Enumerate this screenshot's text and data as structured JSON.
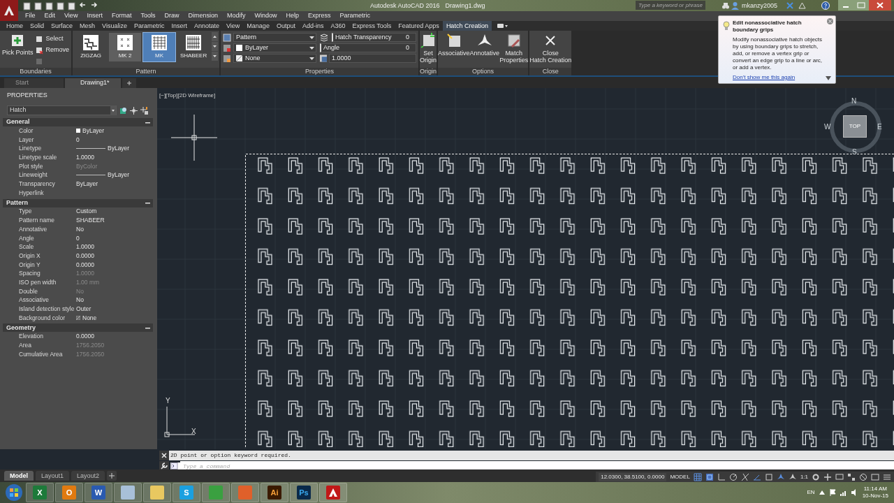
{
  "title_bar": {
    "title": "Autodesk AutoCAD 2016",
    "document": "Drawing1.dwg",
    "search": {
      "placeholder": "Type a keyword or phrase"
    },
    "user": "mkanzy2005"
  },
  "menu_bar": [
    "File",
    "Edit",
    "View",
    "Insert",
    "Format",
    "Tools",
    "Draw",
    "Dimension",
    "Modify",
    "Window",
    "Help",
    "Express",
    "Parametric"
  ],
  "ribbon_tabs": [
    {
      "label": "Home",
      "selected": false
    },
    {
      "label": "Solid",
      "selected": false
    },
    {
      "label": "Surface",
      "selected": false
    },
    {
      "label": "Mesh",
      "selected": false
    },
    {
      "label": "Visualize",
      "selected": false
    },
    {
      "label": "Parametric",
      "selected": false
    },
    {
      "label": "Insert",
      "selected": false
    },
    {
      "label": "Annotate",
      "selected": false
    },
    {
      "label": "View",
      "selected": false
    },
    {
      "label": "Manage",
      "selected": false
    },
    {
      "label": "Output",
      "selected": false
    },
    {
      "label": "Add-ins",
      "selected": false
    },
    {
      "label": "A360",
      "selected": false
    },
    {
      "label": "Express Tools",
      "selected": false
    },
    {
      "label": "Featured Apps",
      "selected": false
    },
    {
      "label": "Hatch Creation",
      "selected": true
    }
  ],
  "ribbon": {
    "boundaries": {
      "title": "Boundaries",
      "pick_points": "Pick Points",
      "tools": [
        {
          "label": "Select",
          "disabled": false
        },
        {
          "label": "Remove",
          "disabled": false
        },
        {
          "disabled": true
        }
      ]
    },
    "pattern": {
      "title": "Pattern",
      "items": [
        {
          "label": "ZIGZAG",
          "selected": false,
          "hovered": false
        },
        {
          "label": "MK 2",
          "selected": false,
          "hovered": true
        },
        {
          "label": "MK",
          "selected": true,
          "hovered": false
        },
        {
          "label": "SHABEER",
          "selected": false,
          "hovered": false
        }
      ]
    },
    "properties": {
      "title": "Properties",
      "type": "Pattern",
      "hatch_color": "ByLayer",
      "background": "None",
      "transparency": {
        "label": "Hatch Transparency",
        "value": "0"
      },
      "angle": {
        "label": "Angle",
        "value": "0"
      },
      "scale": "1.0000"
    },
    "origin": {
      "title": "Origin",
      "button": [
        "Set",
        "Origin"
      ]
    },
    "options": {
      "title": "Options",
      "buttons": [
        {
          "kind": "associative",
          "lines": [
            "Associative"
          ]
        },
        {
          "kind": "annotative",
          "lines": [
            "Annotative"
          ]
        },
        {
          "kind": "match",
          "lines": [
            "Match",
            "Properties"
          ]
        }
      ]
    },
    "close": {
      "title": "Close",
      "button": [
        "Close",
        "Hatch Creation"
      ]
    }
  },
  "tooltip": {
    "title": "Edit nonassociative hatch boundary grips",
    "body": "Modify nonassociative hatch objects by using boundary grips to stretch, add, or remove a vertex grip or convert an edge grip to a line or arc, or add a vertex.",
    "link": "Don't show me this again"
  },
  "document_tabs": [
    {
      "label": "Start",
      "selected": false
    },
    {
      "label": "Drawing1*",
      "selected": true
    }
  ],
  "properties_palette": {
    "title": "PROPERTIES",
    "object": "Hatch",
    "sections": [
      {
        "title": "General",
        "expanded": true,
        "rows": [
          {
            "label": "Color",
            "value": "ByLayer",
            "kind": "swatch",
            "disabled": false
          },
          {
            "label": "Layer",
            "value": "0",
            "kind": "text",
            "disabled": false
          },
          {
            "label": "Linetype",
            "value": "ByLayer",
            "kind": "line",
            "disabled": false
          },
          {
            "label": "Linetype scale",
            "value": "1.0000",
            "kind": "text",
            "disabled": false
          },
          {
            "label": "Plot style",
            "value": "ByColor",
            "kind": "text",
            "disabled": true
          },
          {
            "label": "Lineweight",
            "value": "ByLayer",
            "kind": "line",
            "disabled": false
          },
          {
            "label": "Transparency",
            "value": "ByLayer",
            "kind": "text",
            "disabled": false
          },
          {
            "label": "Hyperlink"
          }
        ]
      },
      {
        "title": "Pattern",
        "expanded": true,
        "rows": [
          {
            "label": "Type",
            "value": "Custom",
            "kind": "text",
            "disabled": false
          },
          {
            "label": "Pattern name",
            "value": "SHABEER",
            "kind": "text",
            "disabled": false
          },
          {
            "label": "Annotative",
            "value": "No",
            "kind": "text",
            "disabled": false
          },
          {
            "label": "Angle",
            "value": "0",
            "kind": "text",
            "disabled": false
          },
          {
            "label": "Scale",
            "value": "1.0000",
            "kind": "text",
            "disabled": false
          },
          {
            "label": "Origin X",
            "value": "0.0000",
            "kind": "text",
            "disabled": false
          },
          {
            "label": "Origin Y",
            "value": "0.0000",
            "kind": "text",
            "disabled": false
          },
          {
            "label": "Spacing",
            "value": "1.0000",
            "kind": "text",
            "disabled": true
          },
          {
            "label": "ISO pen width",
            "value": "1.00 mm",
            "kind": "text",
            "disabled": true
          },
          {
            "label": "Double",
            "value": "No",
            "kind": "text",
            "disabled": true
          },
          {
            "label": "Associative",
            "value": "No",
            "kind": "text",
            "disabled": false
          },
          {
            "label": "Island detection style",
            "value": "Outer",
            "kind": "text",
            "disabled": false
          },
          {
            "label": "Background color",
            "value": "None",
            "kind": "none_swatch",
            "disabled": false
          }
        ]
      },
      {
        "title": "Geometry",
        "expanded": true,
        "rows": [
          {
            "label": "Elevation",
            "value": "0.0000",
            "kind": "text",
            "disabled": false
          },
          {
            "label": "Area",
            "value": "1756.2050",
            "kind": "text",
            "disabled": true
          },
          {
            "label": "Cumulative Area",
            "value": "1756.2050",
            "kind": "text",
            "disabled": true
          }
        ]
      }
    ]
  },
  "viewport": {
    "label": "[−][Top][2D Wireframe]",
    "viewcube": {
      "top": "TOP",
      "north": "N",
      "south": "S",
      "east": "E",
      "west": "W"
    },
    "ucs": {
      "x": "X",
      "y": "Y"
    }
  },
  "command_line": {
    "history": "2D point or option keyword required.",
    "placeholder": "Type a command"
  },
  "layout_tabs": [
    {
      "label": "Model",
      "selected": true
    },
    {
      "label": "Layout1",
      "selected": false
    },
    {
      "label": "Layout2",
      "selected": false
    }
  ],
  "status_bar": {
    "coordinates": "12.0300, 38.5100, 0.0000",
    "space": "MODEL",
    "scale": "1:1"
  },
  "taskbar": {
    "apps": [
      {
        "kind": "excel",
        "label": "X"
      },
      {
        "kind": "outlook",
        "label": "O"
      },
      {
        "kind": "word",
        "label": "W"
      },
      {
        "kind": "calculator"
      },
      {
        "kind": "explorer"
      },
      {
        "kind": "skype",
        "label": "S"
      },
      {
        "kind": "media"
      },
      {
        "kind": "firefox"
      },
      {
        "kind": "illustrator",
        "label": "Ai"
      },
      {
        "kind": "photoshop",
        "label": "Ps"
      },
      {
        "kind": "autocad"
      }
    ],
    "language": "EN",
    "time": "11:14 AM",
    "date": "10-Nov-15"
  }
}
